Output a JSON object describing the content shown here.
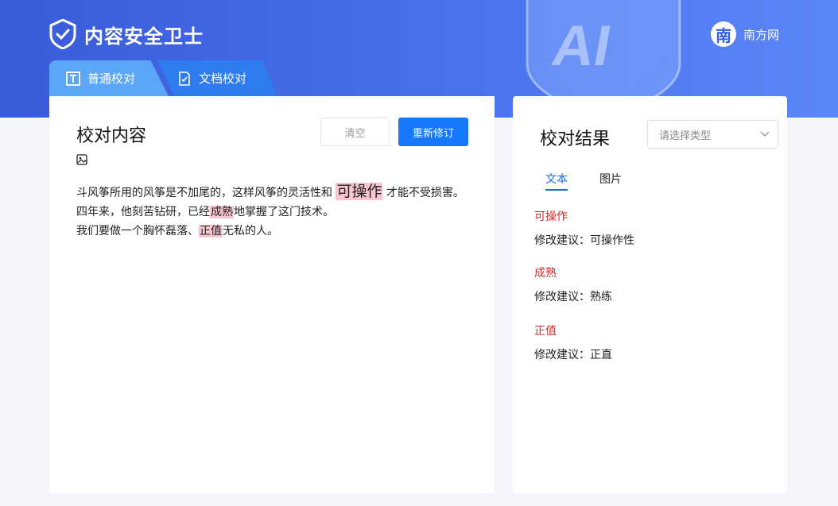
{
  "header": {
    "logo_text": "内容安全卫士",
    "site_badge": "南",
    "site_name": "南方网",
    "shield_letters": "AI"
  },
  "tabs": [
    {
      "label": "普通校对",
      "icon": "text-format-icon",
      "active": true
    },
    {
      "label": "文档校对",
      "icon": "document-check-icon",
      "active": false
    }
  ],
  "left": {
    "title": "校对内容",
    "clear_label": "清空",
    "revise_label": "重新修订",
    "lines": {
      "l1a": "斗风筝所用的风筝是不加尾的，这样风筝的灵活性和",
      "l1hl": "可操作",
      "l1b": "才能不受损害。",
      "l2a": "四年来，他刻苦钻研，已经",
      "l2hl": "成熟",
      "l2b": "地掌握了这门技术。",
      "l3a": "我们要做一个胸怀磊落、",
      "l3hl": "正值",
      "l3b": "无私的人。"
    }
  },
  "right": {
    "title": "校对结果",
    "select_placeholder": "请选择类型",
    "tab_text": "文本",
    "tab_image": "图片",
    "results": [
      {
        "word": "可操作",
        "suggestion": "修改建议：可操作性"
      },
      {
        "word": "成熟",
        "suggestion": "修改建议：熟练"
      },
      {
        "word": "正值",
        "suggestion": "修改建议：正直"
      }
    ]
  },
  "colors": {
    "accent": "#1677ff",
    "highlight": "#f7c5cf",
    "error_word": "#d22b2b"
  }
}
